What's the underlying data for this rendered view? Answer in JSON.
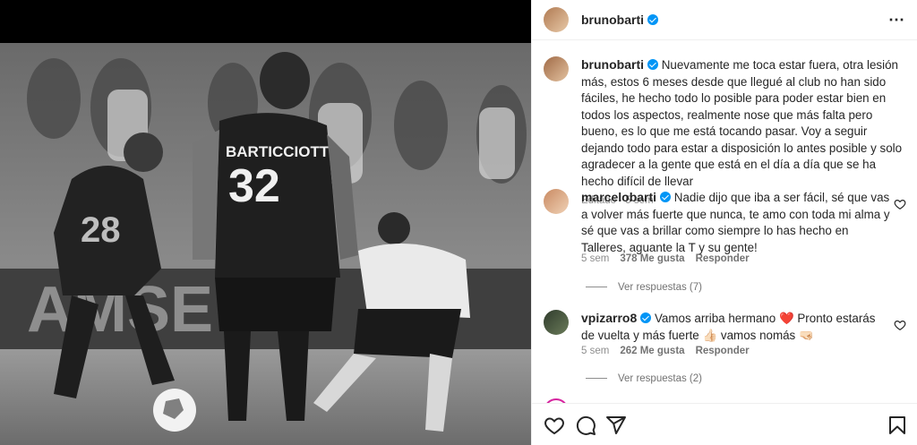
{
  "post": {
    "username": "brunobarti",
    "more_icon": "⋯",
    "caption": "Nuevamente me toca estar fuera, otra lesión más, estos 6 meses desde que llegué al club no han sido fáciles, he hecho todo lo posible para poder estar bien en todos los aspectos, realmente nose que más falta pero bueno, es lo que me está tocando pasar. Voy a seguir dejando todo para estar a disposición lo antes posible y solo agradecer a la gente que está en el día a día que se ha hecho difícil de llevar",
    "caption_meta": "Editado · 5 sem",
    "photo_jersey_name": "BARTICCIOTTO",
    "photo_jersey_number": "32"
  },
  "comments": [
    {
      "username": "marcelobarti",
      "text": "Nadie dijo que iba a ser fácil, sé que vas a volver más fuerte que nunca, te amo con toda mi alma y sé que vas a brillar como siempre lo has hecho en Talleres, aguante la T y su gente!",
      "time": "5 sem",
      "likes": "378 Me gusta",
      "reply": "Responder",
      "view_replies": "Ver respuestas (7)"
    },
    {
      "username": "vpizarro8",
      "text_a": "Vamos arriba hermano",
      "emoji_a": "❤️",
      "text_b": "Pronto estarás de vuelta y más fuerte",
      "emoji_b": "👍🏻",
      "text_c": "vamos nomás",
      "emoji_c": "🤜🏻",
      "time": "5 sem",
      "likes": "262 Me gusta",
      "reply": "Responder",
      "view_replies": "Ver respuestas (2)"
    }
  ],
  "icons": {
    "like": "heart-icon",
    "comment": "comment-icon",
    "share": "share-icon",
    "save": "bookmark-icon"
  },
  "colors": {
    "verified": "#0095f6",
    "like_red": "#ed4956",
    "text": "#262626",
    "secondary": "#8e8e8e"
  }
}
